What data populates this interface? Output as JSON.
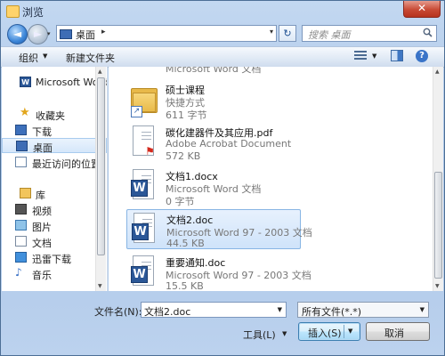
{
  "window": {
    "title": "浏览",
    "close_label": "✕"
  },
  "address": {
    "location": "桌面",
    "chevron": "▸",
    "dropdown": "▾"
  },
  "nav_controls": {
    "back": "◄",
    "forward": "►",
    "history": "▾",
    "refresh": "↻"
  },
  "search": {
    "placeholder": "搜索 桌面",
    "icon": "search-icon"
  },
  "toolbar": {
    "organize": "组织",
    "organize_arrow": "▼",
    "new_folder": "新建文件夹",
    "view_arrow": "▼",
    "help": "?"
  },
  "nav_pane": {
    "items": [
      {
        "label": "Microsoft Word",
        "icon": "word-icon",
        "badge": "W"
      },
      {
        "label": "收藏夹",
        "icon": "star-icon",
        "glyph": "★"
      },
      {
        "label": "下载",
        "icon": "download-folder-icon"
      },
      {
        "label": "桌面",
        "icon": "desktop-icon",
        "selected": true
      },
      {
        "label": "最近访问的位置",
        "icon": "recent-places-icon"
      },
      {
        "label": "库",
        "icon": "library-icon"
      },
      {
        "label": "视频",
        "icon": "video-icon"
      },
      {
        "label": "图片",
        "icon": "picture-icon"
      },
      {
        "label": "文档",
        "icon": "documents-icon"
      },
      {
        "label": "迅雷下载",
        "icon": "thunder-download-icon"
      },
      {
        "label": "音乐",
        "icon": "music-icon",
        "glyph": "♪"
      }
    ]
  },
  "files": [
    {
      "name": "",
      "type": "Microsoft Word 文档",
      "size": "",
      "kind": "word",
      "partial": true
    },
    {
      "name": "硕士课程",
      "type": "快捷方式",
      "size": "611 字节",
      "kind": "shortcut-folder"
    },
    {
      "name": "碳化建器件及其应用.pdf",
      "type": "Adobe Acrobat Document",
      "size": "572 KB",
      "kind": "pdf"
    },
    {
      "name": "文档1.docx",
      "type": "Microsoft Word 文档",
      "size": "0 字节",
      "kind": "word"
    },
    {
      "name": "文档2.doc",
      "type": "Microsoft Word 97 - 2003 文档",
      "size": "44.5 KB",
      "kind": "word",
      "selected": true
    },
    {
      "name": "重要通知.doc",
      "type": "Microsoft Word 97 - 2003 文档",
      "size": "15.5 KB",
      "kind": "word"
    }
  ],
  "file_icons": {
    "word_badge": "W",
    "pdf_badge": "⚑",
    "shortcut_badge": "↗"
  },
  "bottom": {
    "filename_label": "文件名(N):",
    "filename_value": "文档2.doc",
    "filter_value": "所有文件(*.*)",
    "dropdown": "▼",
    "tools_label": "工具(L)",
    "insert_label": "插入(S)",
    "cancel_label": "取消"
  },
  "colors": {
    "accent": "#3e6db5",
    "selection": "#cfe3fa",
    "close": "#c84a35",
    "word": "#2b5797",
    "pdf": "#d42a1e"
  }
}
